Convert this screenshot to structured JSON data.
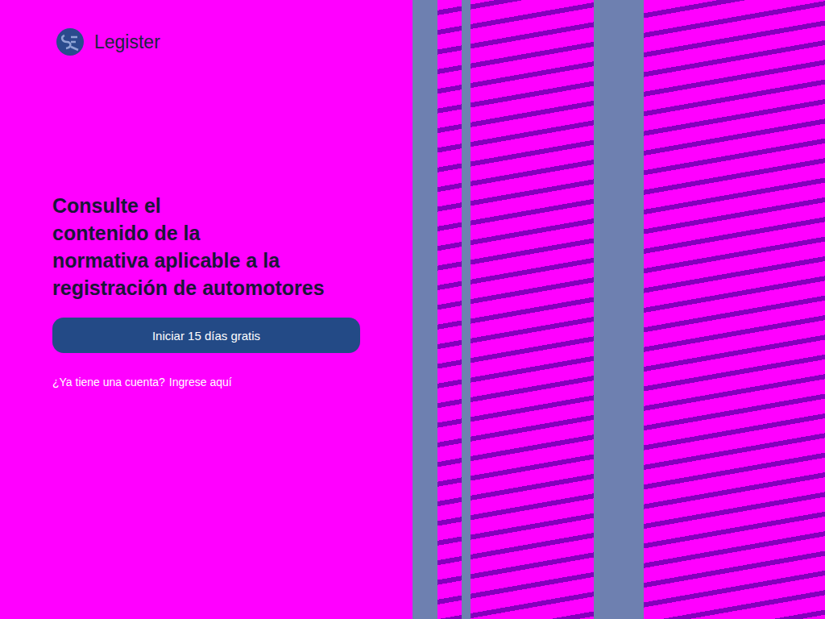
{
  "brand": {
    "name": "Legister"
  },
  "hero": {
    "headline_lines": [
      "Consulte el",
      "contenido de la",
      "normativa aplicable a la",
      "registración de automotores"
    ]
  },
  "cta_button": {
    "label": "Iniciar 15 días gratis"
  },
  "login_prompt": {
    "text": "¿Ya tiene una cuenta?",
    "link": "Ingrese aquí"
  }
}
